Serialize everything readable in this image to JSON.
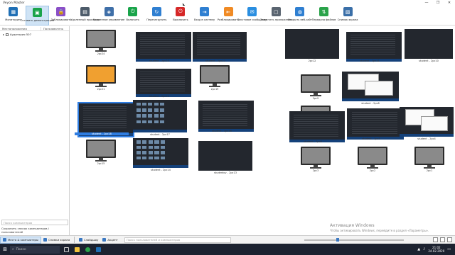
{
  "window": {
    "title": "Veyon Master",
    "controls": [
      "—",
      "❐",
      "✕"
    ]
  },
  "toolbar": [
    {
      "label": "Мониторинг",
      "icon": "monitor-grid-icon",
      "color": "#1f6fb5"
    },
    {
      "label": "Оставить демонстрацию",
      "icon": "screen-share-icon",
      "color": "#1aa34a",
      "active": true
    },
    {
      "label": "Заблокировать",
      "icon": "lock-icon",
      "color": "#8a4fc7"
    },
    {
      "label": "Удаленный просмотр",
      "icon": "remote-view-icon",
      "color": "#4d5b6a"
    },
    {
      "label": "Удаленное управление",
      "icon": "remote-control-icon",
      "color": "#3f6fa8"
    },
    {
      "label": "Включить",
      "icon": "power-on-icon",
      "color": "#19a44a"
    },
    {
      "label": "Перезагрузить",
      "icon": "reboot-icon",
      "color": "#2f7fd1"
    },
    {
      "label": "Выключить",
      "icon": "power-off-icon",
      "color": "#d62828"
    },
    {
      "label": "Вход в систему",
      "icon": "login-icon",
      "color": "#2f7fd1"
    },
    {
      "label": "Разблокировать",
      "icon": "logout-icon",
      "color": "#f08a24"
    },
    {
      "label": "Текстовое сообщение",
      "icon": "message-icon",
      "color": "#2a8ee0"
    },
    {
      "label": "Запустить приложения",
      "icon": "app-launch-icon",
      "color": "#5a6470"
    },
    {
      "label": "Открыть веб-сайт",
      "icon": "website-icon",
      "color": "#2f7fd1"
    },
    {
      "label": "Передача файлов",
      "icon": "file-transfer-icon",
      "color": "#2aa34a"
    },
    {
      "label": "Снимок экрана",
      "icon": "screenshot-icon",
      "color": "#3a6fa8"
    }
  ],
  "sidebar": {
    "col_computers": "Местоположения",
    "col_user": "Пользователь",
    "tree": [
      {
        "label": "Аудитория 507",
        "checked": true
      }
    ],
    "search_placeholder": "Поиск компьютеров",
    "save_label": "Сохранить список компьютеров / пользователей"
  },
  "tiles": [
    {
      "kind": "mon",
      "caption": "2pc24",
      "screen": "#8a8a8a"
    },
    {
      "kind": "shot",
      "caption": "student - 2pc23",
      "style": "code"
    },
    {
      "kind": "shot",
      "caption": "student - 2pc22",
      "style": "code"
    },
    {
      "kind": "mon",
      "caption": "2pc21",
      "screen": "#f0a030"
    },
    {
      "kind": "shot",
      "caption": "student - 2pc20",
      "style": "code"
    },
    {
      "kind": "mon",
      "caption": "2pc19",
      "screen": "#8a8a8a"
    },
    {
      "kind": "shot",
      "caption": "student - 2pc18",
      "style": "code",
      "selected": true
    },
    {
      "kind": "shot",
      "caption": "student - 2pc17",
      "style": "gallery"
    },
    {
      "kind": "shot",
      "caption": "student - 2pc16",
      "style": "code"
    },
    {
      "kind": "mon",
      "caption": "2pc15",
      "screen": "#8a8a8a"
    },
    {
      "kind": "shot",
      "caption": "student - 2pc14",
      "style": "gallery"
    },
    {
      "kind": "shot",
      "caption": "studentov - 2pc13",
      "style": "lake"
    },
    {
      "kind": "shot",
      "caption": "2pc12",
      "style": "bluescr"
    },
    {
      "kind": "shot",
      "caption": "student - 2pc11",
      "style": "code"
    },
    {
      "kind": "shot",
      "caption": "student - 2pc10",
      "style": "lake"
    },
    {
      "kind": "mon",
      "caption": "2pc9",
      "screen": "#8a8a8a"
    },
    {
      "kind": "shot",
      "caption": "student - 2pc8",
      "style": "desk"
    },
    {
      "kind": "mon",
      "caption": "2pc7",
      "screen": "#8a8a8a"
    },
    {
      "kind": "shot",
      "caption": "student - 2pc6",
      "style": "code"
    },
    {
      "kind": "shot",
      "caption": "student - 2pc5",
      "style": "code"
    },
    {
      "kind": "shot",
      "caption": "student - 2pc4",
      "style": "desk"
    },
    {
      "kind": "mon",
      "caption": "2pc3",
      "screen": "#8a8a8a"
    },
    {
      "kind": "mon",
      "caption": "2pc2",
      "screen": "#8a8a8a"
    },
    {
      "kind": "mon",
      "caption": "2pc1",
      "screen": "#8a8a8a"
    }
  ],
  "statusbar": {
    "places": "Места & компьютеры",
    "screenshots": "Снимки экрана",
    "slideshow": "Слайдшоу",
    "spotlight": "Акцент",
    "search_placeholder": "Поиск пользователей и компьютеров"
  },
  "watermark": {
    "line1": "Активация Windows",
    "line2": "Чтобы активировать Windows, перейдите в раздел «Параметры»."
  },
  "taskbar": {
    "search": "Поиск",
    "time": "21:02",
    "date": "24.02.2020"
  }
}
